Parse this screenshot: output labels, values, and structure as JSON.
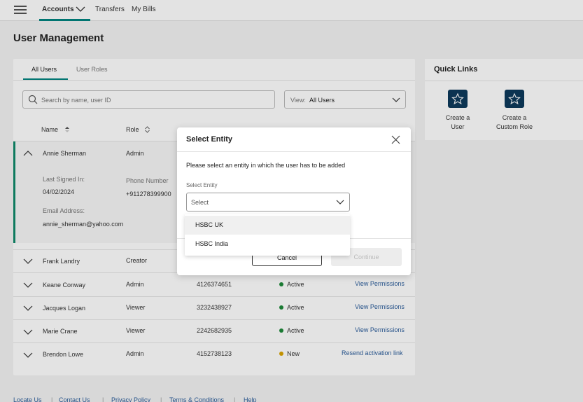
{
  "nav": {
    "items": [
      {
        "label": "Accounts"
      },
      {
        "label": "Transfers"
      },
      {
        "label": "My Bills"
      }
    ]
  },
  "page": {
    "title": "User Management"
  },
  "tabs": [
    {
      "label": "All Users"
    },
    {
      "label": "User Roles"
    }
  ],
  "search": {
    "placeholder": "Search by name, user ID"
  },
  "view_select": {
    "label": "View:",
    "value": "All Users"
  },
  "columns": {
    "name": "Name",
    "role": "Role"
  },
  "expanded_user": {
    "name": "Annie Sherman",
    "role": "Admin",
    "last_signed_label": "Last Signed In:",
    "last_signed_value": "04/02/2024",
    "phone_label": "Phone Number",
    "phone_value": "+911278399900",
    "email_label": "Email Address:",
    "email_value": "annie_sherman@yahoo.com"
  },
  "users": [
    {
      "name": "Frank Landry",
      "role": "Creator",
      "phone": "",
      "status": "",
      "action": ""
    },
    {
      "name": "Keane Conway",
      "role": "Admin",
      "phone": "4126374651",
      "status": "Active",
      "action": "View Permissions"
    },
    {
      "name": "Jacques Logan",
      "role": "Viewer",
      "phone": "3232438927",
      "status": "Active",
      "action": "View Permissions"
    },
    {
      "name": "Marie Crane",
      "role": "Viewer",
      "phone": "2242682935",
      "status": "Active",
      "action": "View Permissions"
    },
    {
      "name": "Brendon Lowe",
      "role": "Admin",
      "phone": "4152738123",
      "status": "New",
      "action": "Resend activation link"
    }
  ],
  "quick_links": {
    "title": "Quick Links",
    "items": [
      {
        "label_line1": "Create a",
        "label_line2": "User"
      },
      {
        "label_line1": "Create a",
        "label_line2": "Custom Role"
      }
    ]
  },
  "footer": {
    "links": [
      {
        "label": "Locate Us"
      },
      {
        "label": "Contact Us"
      },
      {
        "label": "Privacy Policy"
      },
      {
        "label": "Terms & Conditions"
      },
      {
        "label": "Help"
      }
    ]
  },
  "modal": {
    "title": "Select Entity",
    "description": "Please select an entity in which the user has to be added",
    "field_label": "Select Entity",
    "select_placeholder": "Select",
    "options": [
      {
        "label": "HSBC UK"
      },
      {
        "label": "HSBC India"
      }
    ],
    "cancel_label": "Cancel",
    "continue_label": "Continue"
  },
  "colors": {
    "accent": "#00847f",
    "active_status": "#1e8a3a",
    "new_status": "#d9a300",
    "link": "#2a5c9a",
    "quick_link_icon_bg": "#0d3a5c"
  }
}
